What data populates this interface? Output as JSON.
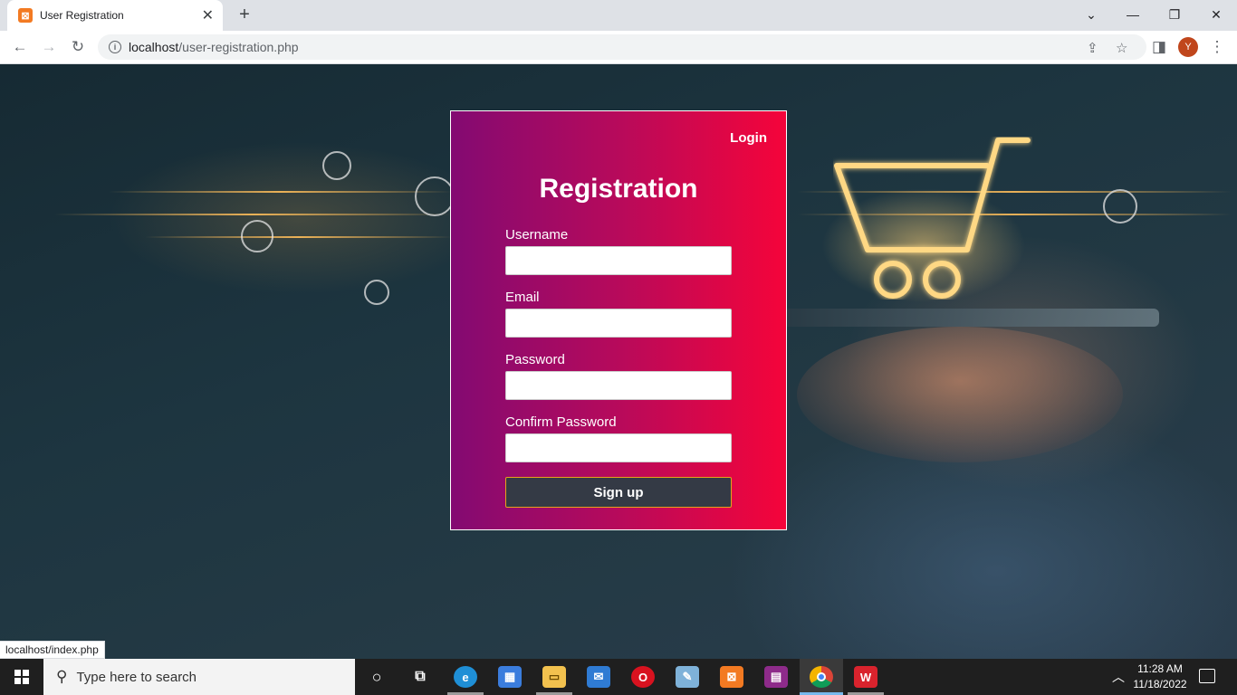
{
  "browser": {
    "tab_title": "User Registration",
    "new_tab_label": "+",
    "url_host": "localhost",
    "url_path": "/user-registration.php",
    "profile_initial": "Y",
    "status_url": "localhost/index.php"
  },
  "page": {
    "login_link": "Login",
    "title": "Registration",
    "fields": [
      {
        "label": "Username",
        "value": ""
      },
      {
        "label": "Email",
        "value": ""
      },
      {
        "label": "Password",
        "value": ""
      },
      {
        "label": "Confirm Password",
        "value": ""
      }
    ],
    "signup_label": "Sign up"
  },
  "taskbar": {
    "search_placeholder": "Type here to search",
    "time": "11:28 AM",
    "date": "11/18/2022"
  },
  "colors": {
    "card_gradient_start": "#830a72",
    "card_gradient_end": "#f5043a",
    "signup_bg": "#343a45",
    "signup_border": "#e6a21b"
  }
}
